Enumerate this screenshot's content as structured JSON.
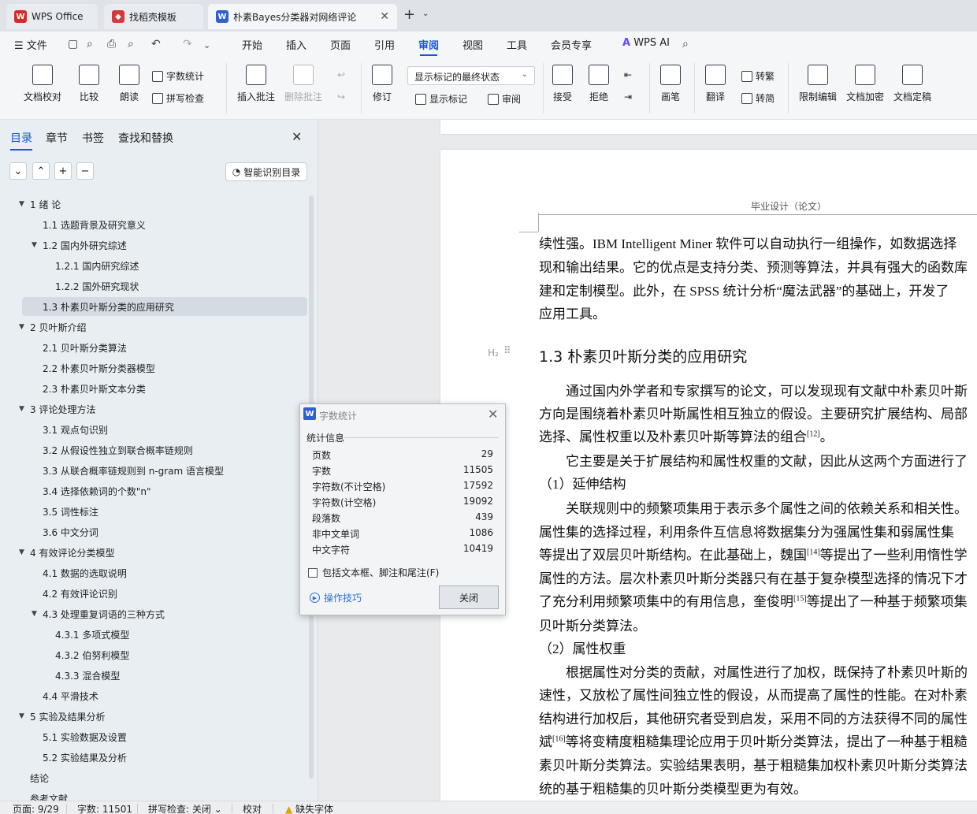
{
  "tabs": [
    {
      "label": "WPS Office",
      "color": "#d42a2a"
    },
    {
      "label": "找稻壳模板",
      "color": "#d43a3a"
    },
    {
      "label": "朴素Bayes分类器对网络评论",
      "color": "#2f5fd0"
    }
  ],
  "menu": {
    "file": "文件",
    "items": [
      "开始",
      "插入",
      "页面",
      "引用",
      "审阅",
      "视图",
      "工具",
      "会员专享"
    ],
    "active": "审阅",
    "ai": "WPS AI"
  },
  "ribbon": {
    "doc_check": "文档校对",
    "compare": "比较",
    "read_aloud": "朗读",
    "word_count": "字数统计",
    "spell_check": "拼写检查",
    "insert_comment": "插入批注",
    "delete_comment": "删除批注",
    "revise": "修订",
    "markup_dropdown": "显示标记的最终状态",
    "show_markup": "显示标记",
    "review": "审阅",
    "accept": "接受",
    "reject": "拒绝",
    "pen": "画笔",
    "translate": "翻译",
    "to_traditional": "转繁",
    "to_simplified": "转简",
    "restrict_edit": "限制编辑",
    "encrypt": "文档加密",
    "finalize": "文档定稿"
  },
  "sidebar": {
    "tabs": [
      "目录",
      "章节",
      "书签",
      "查找和替换"
    ],
    "active_tab": "目录",
    "smart_btn": "智能识别目录",
    "toc": [
      {
        "label": "1 绪 论",
        "level": 1,
        "expanded": true
      },
      {
        "label": "1.1 选题背景及研究意义",
        "level": 2
      },
      {
        "label": "1.2 国内外研究综述",
        "level": 2,
        "expanded": true
      },
      {
        "label": "1.2.1 国内研究综述",
        "level": 3
      },
      {
        "label": "1.2.2 国外研究现状",
        "level": 3
      },
      {
        "label": "1.3 朴素贝叶斯分类的应用研究",
        "level": 2,
        "selected": true
      },
      {
        "label": "2 贝叶斯介绍",
        "level": 1,
        "expanded": true
      },
      {
        "label": "2.1 贝叶斯分类算法",
        "level": 2
      },
      {
        "label": "2.2 朴素贝叶斯分类器模型",
        "level": 2
      },
      {
        "label": "2.3 朴素贝叶斯文本分类",
        "level": 2
      },
      {
        "label": "3 评论处理方法",
        "level": 1,
        "expanded": true
      },
      {
        "label": "3.1 观点句识别",
        "level": 2
      },
      {
        "label": "3.2 从假设性独立到联合概率链规则",
        "level": 2
      },
      {
        "label": "3.3 从联合概率链规则到 n-gram 语言模型",
        "level": 2
      },
      {
        "label": "3.4 选择依赖词的个数\"n\"",
        "level": 2
      },
      {
        "label": "3.5 词性标注",
        "level": 2
      },
      {
        "label": "3.6 中文分词",
        "level": 2
      },
      {
        "label": "4 有效评论分类模型",
        "level": 1,
        "expanded": true
      },
      {
        "label": "4.1 数据的选取说明",
        "level": 2
      },
      {
        "label": "4.2 有效评论识别",
        "level": 2
      },
      {
        "label": "4.3 处理重复词语的三种方式",
        "level": 2,
        "expanded": true
      },
      {
        "label": "4.3.1 多项式模型",
        "level": 3
      },
      {
        "label": "4.3.2 伯努利模型",
        "level": 3
      },
      {
        "label": "4.3.3 混合模型",
        "level": 3
      },
      {
        "label": "4.4 平滑技术",
        "level": 2
      },
      {
        "label": "5 实验及结果分析",
        "level": 1,
        "expanded": true
      },
      {
        "label": "5.1 实验数据及设置",
        "level": 2
      },
      {
        "label": "5.2 实验结果及分析",
        "level": 2
      },
      {
        "label": "结论",
        "level": 1
      },
      {
        "label": "参考文献",
        "level": 1
      }
    ]
  },
  "document": {
    "header": "毕业设计（论文）",
    "heading": "1.3 朴素贝叶斯分类的应用研究",
    "h2_marker": "H₂",
    "lines_top": [
      "续性强。IBM Intelligent Miner 软件可以自动执行一组操作，如数据选择",
      "现和输出结果。它的优点是支持分类、预测等算法，并具有强大的函数库",
      "建和定制模型。此外，在 SPSS 统计分析“魔法武器”的基础上，开发了",
      "应用工具。"
    ],
    "p1": [
      "　　通过国内外学者和专家撰写的论文，可以发现现有文献中朴素贝叶斯",
      "方向是围绕着朴素贝叶斯属性相互独立的假设。主要研究扩展结构、局部",
      "选择、属性权重以及朴素贝叶斯等算法的组合"
    ],
    "ref12": "[12]",
    "p1_end": "。",
    "p2": "　　它主要是关于扩展结构和属性权重的文献，因此从这两个方面进行了",
    "sec1": "（1）延伸结构",
    "p3": [
      "　　关联规则中的频繁项集用于表示多个属性之间的依赖关系和相关性。",
      "属性集的选择过程，利用条件互信息将数据集分为强属性集和弱属性集",
      "等提出了双层贝叶斯结构。在此基础上，魏国"
    ],
    "ref14": "[14]",
    "p3b": "等提出了一些利用惰性学",
    "p3c": "属性的方法。层次朴素贝叶斯分类器只有在基于复杂模型选择的情况下才",
    "p3d": "了充分利用频繁项集中的有用信息，奎俊明",
    "ref15": "[15]",
    "p3e": "等提出了一种基于频繁项集",
    "p3f": "贝叶斯分类算法。",
    "sec2": "（2）属性权重",
    "p4": [
      "　　根据属性对分类的贡献，对属性进行了加权，既保持了朴素贝叶斯的",
      "速性，又放松了属性间独立性的假设，从而提高了属性的性能。在对朴素",
      "结构进行加权后，其他研究者受到启发，采用不同的方法获得不同的属性"
    ],
    "p4a": "斌",
    "ref16": "[16]",
    "p4b": "等将变精度粗糙集理论应用于贝叶斯分类算法，提出了一种基于粗糙",
    "p4c": "素贝叶斯分类算法。实验结果表明，基于粗糙集加权朴素贝叶斯分类算法",
    "p4d": "统的基于粗糙集的贝叶斯分类模型更为有效。"
  },
  "dialog": {
    "title": "字数统计",
    "section": "统计信息",
    "rows": [
      {
        "label": "页数",
        "value": "29"
      },
      {
        "label": "字数",
        "value": "11505"
      },
      {
        "label": "字符数(不计空格)",
        "value": "17592"
      },
      {
        "label": "字符数(计空格)",
        "value": "19092"
      },
      {
        "label": "段落数",
        "value": "439"
      },
      {
        "label": "非中文单词",
        "value": "1086"
      },
      {
        "label": "中文字符",
        "value": "10419"
      }
    ],
    "checkbox": "包括文本框、脚注和尾注(F)",
    "tips": "操作技巧",
    "close": "关闭"
  },
  "status": {
    "page": "页面: 9/29",
    "words": "字数: 11501",
    "spell": "拼写检查: 关闭",
    "proof": "校对",
    "missing_font": "缺失字体"
  }
}
